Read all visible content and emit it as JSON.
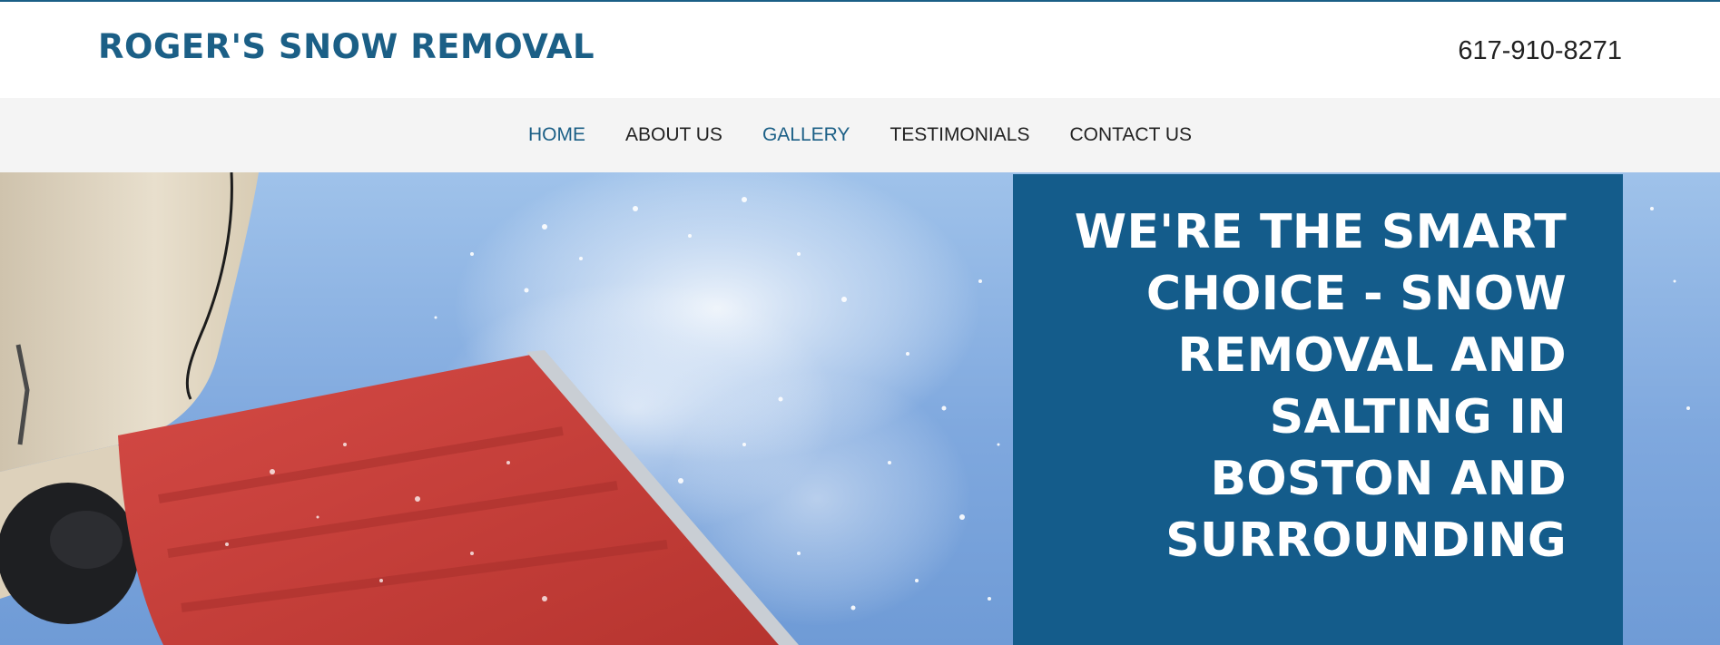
{
  "header": {
    "brand": "ROGER'S SNOW REMOVAL",
    "phone": "617-910-8271"
  },
  "nav": {
    "items": [
      {
        "label": "HOME",
        "active": true
      },
      {
        "label": "ABOUT US",
        "active": false
      },
      {
        "label": "GALLERY",
        "active": false
      },
      {
        "label": "TESTIMONIALS",
        "active": false
      },
      {
        "label": "CONTACT US",
        "active": false
      }
    ]
  },
  "hero": {
    "headline": "WE'RE THE SMART CHOICE - SNOW REMOVAL AND SALTING IN BOSTON AND SURROUNDING"
  },
  "colors": {
    "brand": "#1b5f86",
    "card": "#145c8b",
    "nav_bg": "#f4f4f4",
    "sky": "#7fa8de",
    "shovel": "#c9403c"
  }
}
